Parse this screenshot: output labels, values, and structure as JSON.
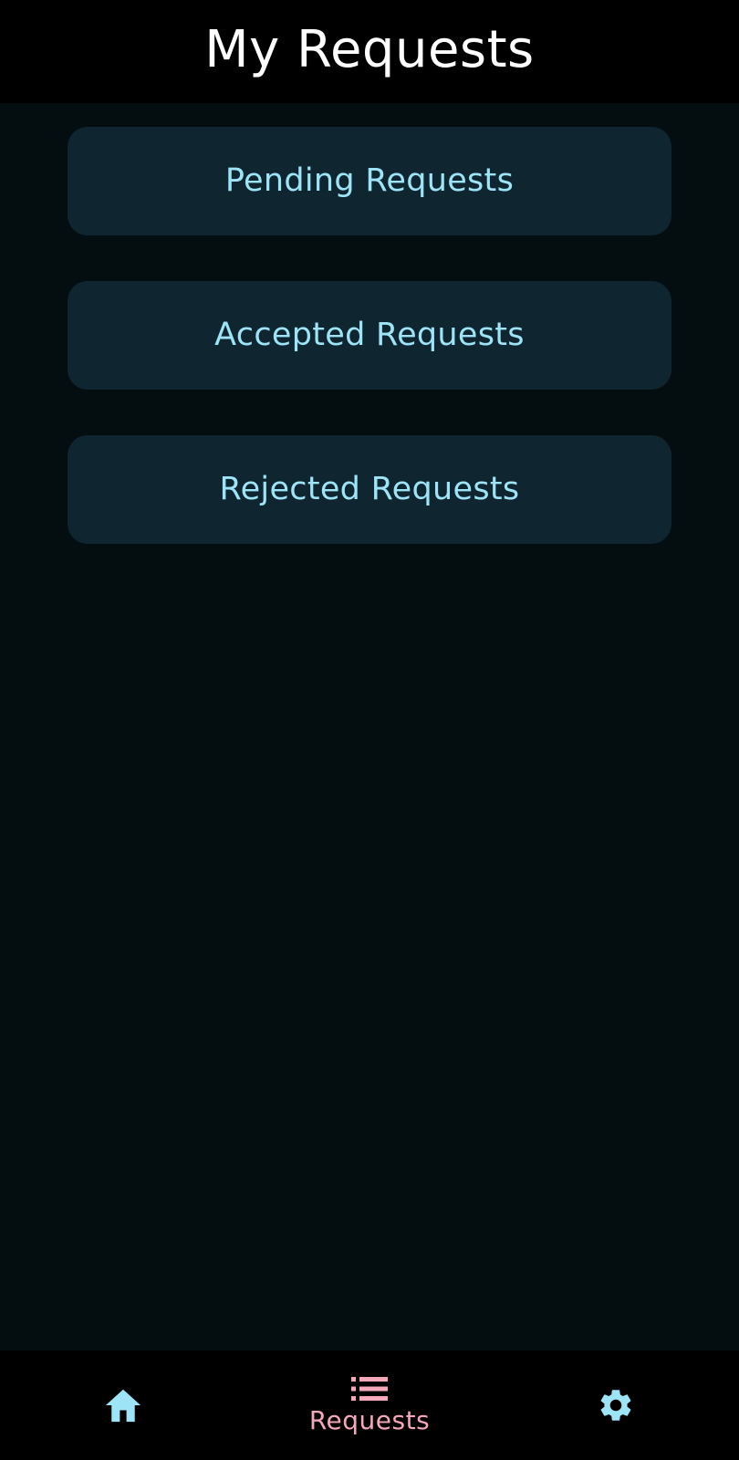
{
  "header": {
    "title": "My Requests"
  },
  "requests": {
    "items": [
      {
        "label": "Pending Requests"
      },
      {
        "label": "Accepted Requests"
      },
      {
        "label": "Rejected Requests"
      }
    ]
  },
  "bottom_nav": {
    "items": [
      {
        "icon": "home-icon",
        "label": "",
        "active": false
      },
      {
        "icon": "list-icon",
        "label": "Requests",
        "active": true
      },
      {
        "icon": "gear-icon",
        "label": "",
        "active": false
      }
    ]
  },
  "colors": {
    "background": "#040e11",
    "bar": "#000000",
    "card": "#0f2530",
    "card_text": "#9ee4f7",
    "active_nav": "#f6a8bb",
    "inactive_nav": "#9ee4f7",
    "title_text": "#ffffff"
  }
}
